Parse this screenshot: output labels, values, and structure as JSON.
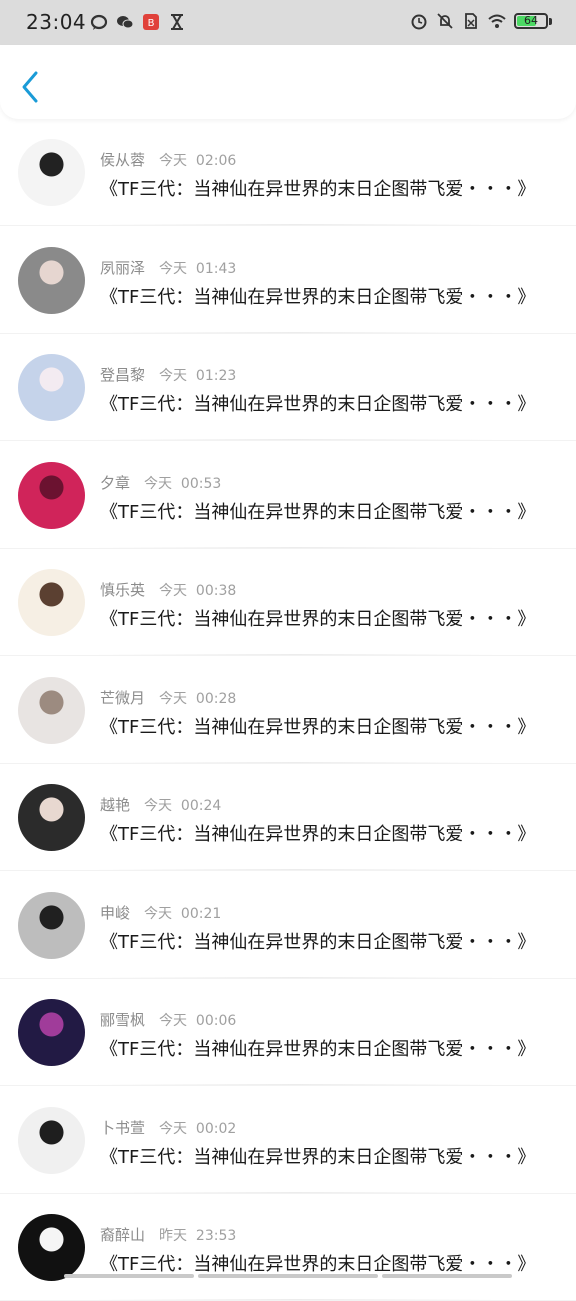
{
  "status": {
    "time": "23:04",
    "battery": "64",
    "left_icons": [
      "chat-bubble-icon",
      "wechat-icon",
      "app-badge-icon",
      "hourglass-icon"
    ],
    "right_icons": [
      "alarm-icon",
      "mute-icon",
      "no-sim-icon",
      "wifi-icon"
    ]
  },
  "header": {
    "back_icon": "chevron-left-icon",
    "accent": "#1a9bd7"
  },
  "messages": [
    {
      "name": "侯从蓉",
      "time": "今天  02:06",
      "text": "《TF三代：当神仙在异世界的末日企图带飞爱・・・》",
      "avatar_colors": [
        "#f4f4f4",
        "#222222"
      ]
    },
    {
      "name": "夙丽泽",
      "time": "今天  01:43",
      "text": "《TF三代：当神仙在异世界的末日企图带飞爱・・・》",
      "avatar_colors": [
        "#8a8a8a",
        "#e6d6d0"
      ]
    },
    {
      "name": "登昌黎",
      "time": "今天  01:23",
      "text": "《TF三代：当神仙在异世界的末日企图带飞爱・・・》",
      "avatar_colors": [
        "#c5d3ea",
        "#f3ebf1"
      ]
    },
    {
      "name": "夕章",
      "time": "今天  00:53",
      "text": "《TF三代：当神仙在异世界的末日企图带飞爱・・・》",
      "avatar_colors": [
        "#d0245a",
        "#6b1230"
      ]
    },
    {
      "name": "慎乐英",
      "time": "今天  00:38",
      "text": "《TF三代：当神仙在异世界的末日企图带飞爱・・・》",
      "avatar_colors": [
        "#f6efe4",
        "#5b4031"
      ]
    },
    {
      "name": "芒微月",
      "time": "今天  00:28",
      "text": "《TF三代：当神仙在异世界的末日企图带飞爱・・・》",
      "avatar_colors": [
        "#e8e4e2",
        "#9c8b80"
      ]
    },
    {
      "name": "越艳",
      "time": "今天  00:24",
      "text": "《TF三代：当神仙在异世界的末日企图带飞爱・・・》",
      "avatar_colors": [
        "#2b2b2b",
        "#e8d8d0"
      ]
    },
    {
      "name": "申峻",
      "time": "今天  00:21",
      "text": "《TF三代：当神仙在异世界的末日企图带飞爱・・・》",
      "avatar_colors": [
        "#bdbdbd",
        "#202020"
      ]
    },
    {
      "name": "郦雪枫",
      "time": "今天  00:06",
      "text": "《TF三代：当神仙在异世界的末日企图带飞爱・・・》",
      "avatar_colors": [
        "#221a44",
        "#a03c9a"
      ]
    },
    {
      "name": "卜书萱",
      "time": "今天  00:02",
      "text": "《TF三代：当神仙在异世界的末日企图带飞爱・・・》",
      "avatar_colors": [
        "#f0f0f0",
        "#1e1e1e"
      ]
    },
    {
      "name": "裔醉山",
      "time": "昨天  23:53",
      "text": "《TF三代：当神仙在异世界的末日企图带飞爱・・・》",
      "avatar_colors": [
        "#111111",
        "#f5f5f5"
      ]
    }
  ]
}
